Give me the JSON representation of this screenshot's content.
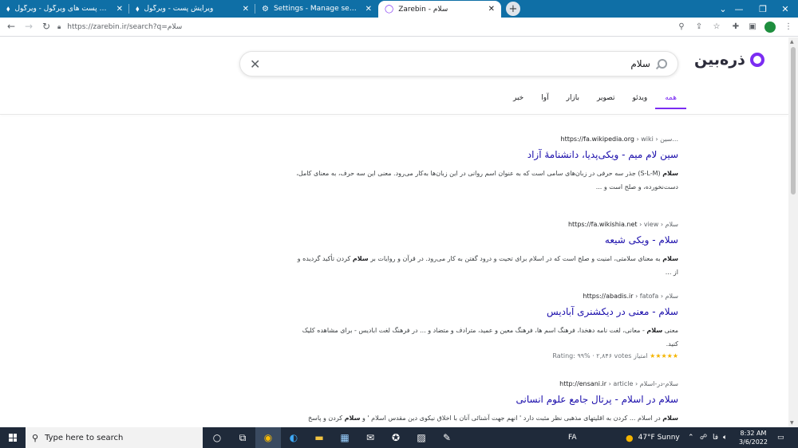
{
  "browser": {
    "tabs": [
      {
        "title": "جدیدترین پست های ویرگول - ویرگول",
        "icon": "virgool-icon"
      },
      {
        "title": "ویرایش پست - ویرگول",
        "icon": "virgool-icon"
      },
      {
        "title": "Settings - Manage search engines",
        "icon": "gear-icon"
      },
      {
        "title": "Zarebin - سلام",
        "icon": "zarebin-icon"
      }
    ],
    "url": "https://zarebin.ir/search?q=سلام"
  },
  "search": {
    "logo_text": "ذره‌بین",
    "query": "سلام",
    "tabs": [
      "همه",
      "ویدئو",
      "تصویر",
      "بازار",
      "آوا",
      "خبر"
    ],
    "active_tab": "همه"
  },
  "results": [
    {
      "url_domain": "https://fa.wikipedia.org",
      "url_path": "› wiki › سین...",
      "title": "سین لام میم - ویکی‌پدیا، دانشنامهٔ آزاد",
      "snippet_line1_bold": "سلام",
      "snippet_line1": " (S-L-M) جذر سه حرفی در زبان‌های سامی است که به عنوان اسم روانی در این زبان‌ها به‌کار می‌رود. معنی این سه حرف، به معنای کامل،",
      "snippet_line2": "دست‌نخورده، و صلح است و ..."
    },
    {
      "url_domain": "https://fa.wikishia.net",
      "url_path": "› view › سلام",
      "title": "سلام - ویکی شیعه",
      "snippet_bold1": "سلام",
      "snippet_mid1": " به معنای سلامتی، امنیت و صلح است که در اسلام برای تحیت و درود گفتن به کار می‌رود. در قرآن و روایات بر ",
      "snippet_bold2": "سلام",
      "snippet_mid2": " کردن تأکید گردیده و از ..."
    },
    {
      "url_domain": "https://abadis.ir",
      "url_path": "› fatofa › سلام",
      "title": "سلام - معنی در دیکشنری آبادیس",
      "snippet_pre": "معنی ",
      "snippet_bold": "سلام",
      "snippet_post": " - معانی، لغت نامه دهخدا، فرهنگ اسم ها، فرهنگ معین و عمید، مترادف و متضاد و ... در فرهنگ لغت ابادیس - برای مشاهده کلیک کنید.",
      "rating_stars": "★★★★★",
      "rating_label": "امتیاز",
      "rating_text": "Rating: ۹۹% · ۲,۸۴۶ votes"
    },
    {
      "url_domain": "http://ensani.ir",
      "url_path": "› article › سلام-در-اسلام",
      "title": "سلام در اسلام - پرتال جامع علوم انسانی",
      "snippet_bold1": "سلام",
      "snippet_mid1": " در اسلام ... کردن به اقلیتهای مذهبی نظر مثبت دارد ' انهم جهت آشنائی آنان با اخلاق نیکوی دین مقدس اسلام ' و ",
      "snippet_bold2": "سلام",
      "snippet_mid2": " کردن و پاسخ گفتن آداب"
    }
  ],
  "taskbar": {
    "search_placeholder": "Type here to search",
    "language": "FA",
    "weather": "47°F  Sunny",
    "tray_lang": "فا",
    "time": "8:32 AM",
    "date": "3/6/2022"
  },
  "colors": {
    "accent": "#7b2cf2",
    "link": "#1a0dab",
    "tabstrip": "#0f6fa6",
    "taskbar": "#1f2a3a"
  }
}
